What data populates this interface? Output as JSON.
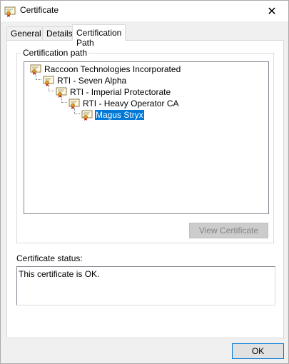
{
  "window": {
    "title": "Certificate",
    "close_glyph": "✕"
  },
  "tabs": [
    {
      "label": "General",
      "active": false
    },
    {
      "label": "Details",
      "active": false
    },
    {
      "label": "Certification Path",
      "active": true
    }
  ],
  "certification_path": {
    "group_label": "Certification path",
    "nodes": [
      {
        "label": "Raccoon Technologies Incorporated",
        "level": 0,
        "selected": false,
        "icon": "certificate-icon"
      },
      {
        "label": "RTI - Seven Alpha",
        "level": 1,
        "selected": false,
        "icon": "certificate-icon"
      },
      {
        "label": "RTI - Imperial Protectorate",
        "level": 2,
        "selected": false,
        "icon": "certificate-icon"
      },
      {
        "label": "RTI - Heavy Operator CA",
        "level": 3,
        "selected": false,
        "icon": "certificate-icon"
      },
      {
        "label": "Magus Stryx",
        "level": 4,
        "selected": true,
        "icon": "certificate-icon"
      }
    ],
    "view_button_label": "View Certificate"
  },
  "status": {
    "label": "Certificate status:",
    "text": "This certificate is OK."
  },
  "footer": {
    "ok_label": "OK"
  },
  "colors": {
    "selection": "#0078d7",
    "focus_border": "#0078d7",
    "disabled_button_bg": "#cccccc"
  }
}
